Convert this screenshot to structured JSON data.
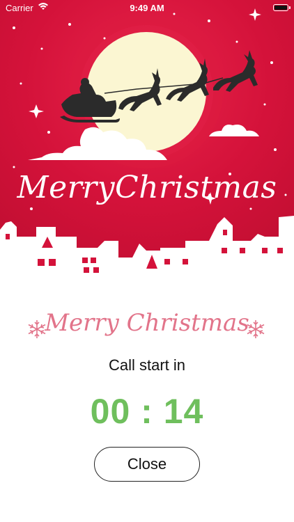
{
  "status_bar": {
    "carrier": "Carrier",
    "time": "9:49 AM"
  },
  "hero": {
    "title": "MerryChristmas",
    "background_color": "#d4123a",
    "moon_color": "#fbf6d2"
  },
  "greeting": "Merry Christmas",
  "call": {
    "label": "Call start in",
    "timer": "00 : 14",
    "timer_color": "#6fbf5d"
  },
  "close_button": {
    "label": "Close"
  },
  "icons": [
    "wifi-icon",
    "battery-icon",
    "snowflake-icon",
    "santa-sleigh-icon",
    "reindeer-icon",
    "moon-icon"
  ]
}
